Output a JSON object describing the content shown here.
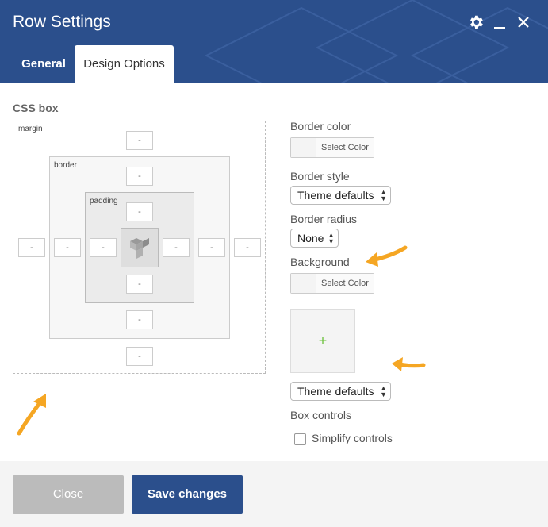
{
  "window": {
    "title": "Row Settings",
    "icons": [
      "gear-icon",
      "minimize-icon",
      "close-icon"
    ],
    "accent_color": "#2b4f8c"
  },
  "tabs": [
    {
      "label": "General",
      "active": false
    },
    {
      "label": "Design Options",
      "active": true
    }
  ],
  "css_box": {
    "title": "CSS box",
    "margin_label": "margin",
    "border_label": "border",
    "padding_label": "padding",
    "margin": {
      "top": "-",
      "right": "-",
      "bottom": "-",
      "left": "-"
    },
    "border": {
      "top": "-",
      "right": "-",
      "bottom": "-",
      "left": "-"
    },
    "padding": {
      "top": "-",
      "right": "-",
      "bottom": "-",
      "left": "-"
    }
  },
  "options": {
    "border_color_label": "Border color",
    "border_color_button": "Select Color",
    "border_style_label": "Border style",
    "border_style_value": "Theme defaults",
    "border_radius_label": "Border radius",
    "border_radius_value": "None",
    "background_label": "Background",
    "background_color_button": "Select Color",
    "background_image_add": "+",
    "background_style_value": "Theme defaults",
    "box_controls_label": "Box controls",
    "simplify_controls_label": "Simplify controls",
    "simplify_controls_checked": false
  },
  "footer": {
    "close_label": "Close",
    "save_label": "Save changes"
  },
  "annotation_color": "#f5a623"
}
